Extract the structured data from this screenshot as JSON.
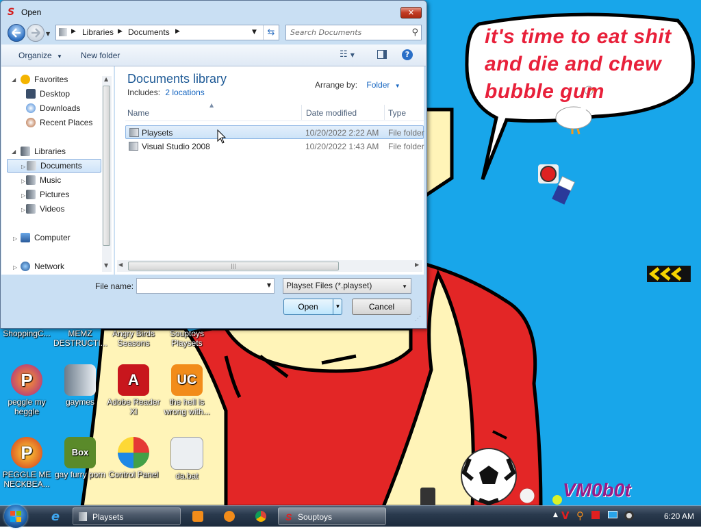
{
  "dialog": {
    "title": "Open",
    "close_label": "✕",
    "breadcrumb": [
      "Libraries",
      "Documents"
    ],
    "search_placeholder": "Search Documents",
    "toolbar": {
      "organize": "Organize",
      "new_folder": "New folder"
    },
    "nav": {
      "favorites": "Favorites",
      "desktop": "Desktop",
      "downloads": "Downloads",
      "recent_places": "Recent Places",
      "libraries": "Libraries",
      "documents": "Documents",
      "music": "Music",
      "pictures": "Pictures",
      "videos": "Videos",
      "computer": "Computer",
      "network": "Network"
    },
    "library": {
      "title": "Documents library",
      "includes_label": "Includes:",
      "includes_link": "2 locations",
      "arrange_label": "Arrange by:",
      "arrange_value": "Folder"
    },
    "columns": {
      "name": "Name",
      "date": "Date modified",
      "type": "Type"
    },
    "files": [
      {
        "name": "Playsets",
        "date": "10/20/2022 2:22 AM",
        "type": "File folder"
      },
      {
        "name": "Visual Studio 2008",
        "date": "10/20/2022 1:43 AM",
        "type": "File folder"
      }
    ],
    "filename_label": "File name:",
    "filename_value": "",
    "filetype_value": "Playset Files (*.playset)",
    "open_label": "Open",
    "cancel_label": "Cancel"
  },
  "wallpaper": {
    "bubble_text": "it's time to eat shit and die and chew bubble gum",
    "watermark": "VM0b0t"
  },
  "desktop_icons": [
    {
      "label": "ShoppingC..."
    },
    {
      "label": "MEMZ DESTRUCTI..."
    },
    {
      "label": "Angry Birds Seasons"
    },
    {
      "label": "Souptoys Playsets"
    },
    {
      "label": "peggle my heggle"
    },
    {
      "label": "gaymes"
    },
    {
      "label": "Adobe Reader XI"
    },
    {
      "label": "the hell is wrong with..."
    },
    {
      "label": "PEGGLE ME NECKBEA..."
    },
    {
      "label": "gay furry porn"
    },
    {
      "label": "Control Panel"
    },
    {
      "label": "da.bat"
    }
  ],
  "taskbar": {
    "playsets_label": "Playsets",
    "souptoys_label": "Souptoys",
    "clock": "6:20 AM"
  },
  "colors": {
    "wallpaper_blue": "#18a6ea",
    "shirt_red": "#e32626",
    "skin_cream": "#fff4b8",
    "text_red": "#e8203a",
    "library_title": "#1e5a96",
    "link_blue": "#1565c0"
  }
}
